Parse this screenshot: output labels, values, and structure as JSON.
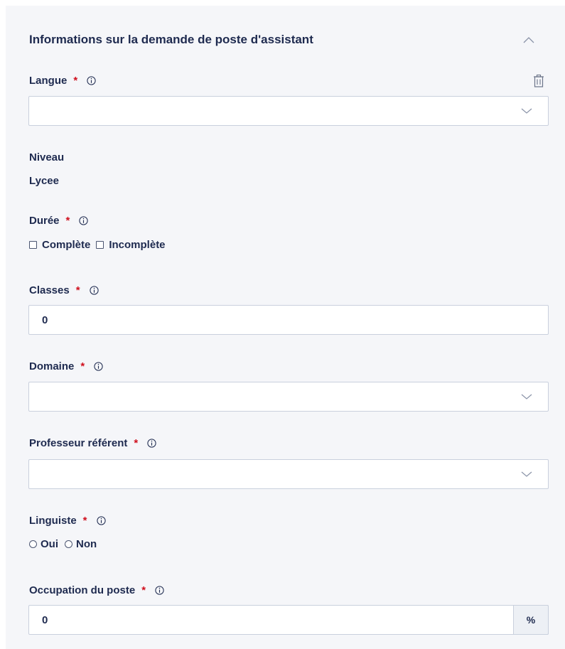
{
  "section": {
    "title": "Informations sur la demande de poste d'assistant",
    "collapse_icon": "chevron-up-icon"
  },
  "langue": {
    "label": "Langue",
    "required": "*",
    "value": ""
  },
  "niveau": {
    "label": "Niveau",
    "value": "Lycee"
  },
  "duree": {
    "label": "Durée",
    "required": "*",
    "options": [
      "Complète",
      "Incomplète"
    ]
  },
  "classes": {
    "label": "Classes",
    "required": "*",
    "value": "0"
  },
  "domaine": {
    "label": "Domaine",
    "required": "*",
    "value": ""
  },
  "professeur": {
    "label": "Professeur référent",
    "required": "*",
    "value": ""
  },
  "linguiste": {
    "label": "Linguiste",
    "required": "*",
    "options": [
      "Oui",
      "Non"
    ]
  },
  "occupation": {
    "label": "Occupation du poste",
    "required": "*",
    "value": "0",
    "suffix": "%"
  },
  "colors": {
    "panel_bg": "#f5f6f9",
    "text": "#1e2a4f",
    "required": "#d0101e",
    "border": "#c9d0dd"
  }
}
